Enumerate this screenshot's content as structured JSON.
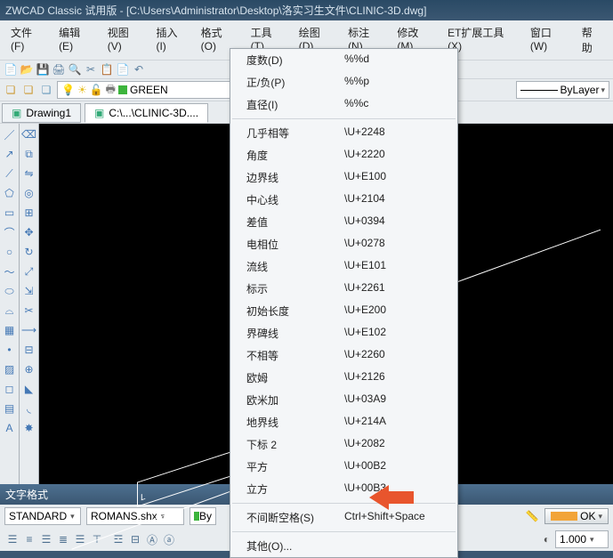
{
  "title": "ZWCAD Classic 试用版 - [C:\\Users\\Administrator\\Desktop\\洛实习生文件\\CLINIC-3D.dwg]",
  "menu": {
    "file": "文件(F)",
    "edit": "编辑(E)",
    "view": "视图(V)",
    "insert": "插入(I)",
    "format": "格式(O)",
    "tools": "工具(T)",
    "draw": "绘图(D)",
    "annotate": "标注(N)",
    "modify": "修改(M)",
    "etext": "ET扩展工具(X)",
    "window": "窗口(W)",
    "help": "帮助"
  },
  "layer": {
    "name": "GREEN",
    "bylayer": "ByLayer"
  },
  "tabs": {
    "drawing1": "Drawing1",
    "clinic": "C:\\...\\CLINIC-3D...."
  },
  "textstyle_title": "文字格式",
  "tf": {
    "style": "STANDARD",
    "font": "ROMANS.shx",
    "by": "By",
    "ok": "OK",
    "num": "1.000"
  },
  "ctx": {
    "g1": [
      {
        "l": "度数(D)",
        "v": "%%d"
      },
      {
        "l": "正/负(P)",
        "v": "%%p"
      },
      {
        "l": "直径(I)",
        "v": "%%c"
      }
    ],
    "g2": [
      {
        "l": "几乎相等",
        "v": "\\U+2248"
      },
      {
        "l": "角度",
        "v": "\\U+2220"
      },
      {
        "l": "边界线",
        "v": "\\U+E100"
      },
      {
        "l": "中心线",
        "v": "\\U+2104"
      },
      {
        "l": "差值",
        "v": "\\U+0394"
      },
      {
        "l": "电相位",
        "v": "\\U+0278"
      },
      {
        "l": "流线",
        "v": "\\U+E101"
      },
      {
        "l": "标示",
        "v": "\\U+2261"
      },
      {
        "l": "初始长度",
        "v": "\\U+E200"
      },
      {
        "l": "界碑线",
        "v": "\\U+E102"
      },
      {
        "l": "不相等",
        "v": "\\U+2260"
      },
      {
        "l": "欧姆",
        "v": "\\U+2126"
      },
      {
        "l": "欧米加",
        "v": "\\U+03A9"
      },
      {
        "l": "地界线",
        "v": "\\U+214A"
      },
      {
        "l": "下标 2",
        "v": "\\U+2082"
      },
      {
        "l": "平方",
        "v": "\\U+00B2"
      },
      {
        "l": "立方",
        "v": "\\U+00B3"
      }
    ],
    "g3": [
      {
        "l": "不间断空格(S)",
        "v": "Ctrl+Shift+Space"
      }
    ],
    "g4": [
      {
        "l": "其他(O)...",
        "v": ""
      }
    ]
  }
}
